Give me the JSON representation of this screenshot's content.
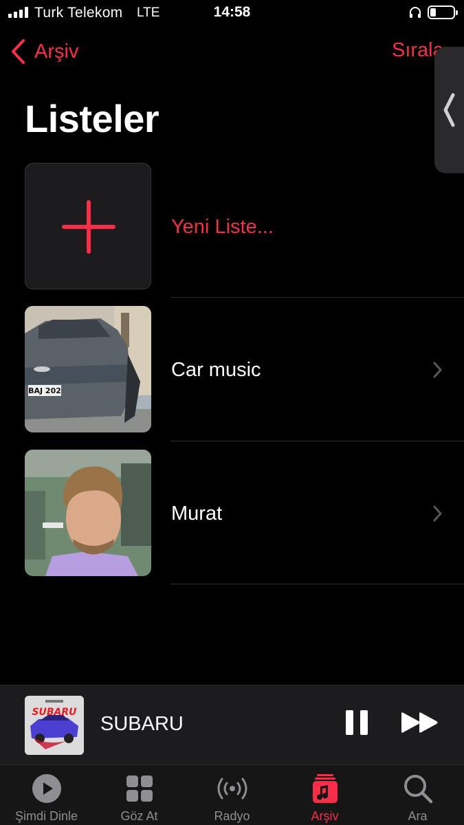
{
  "status_bar": {
    "carrier": "Turk Telekom",
    "network": "LTE",
    "time": "14:58",
    "battery_level": 0.25,
    "icons": [
      "signal-icon",
      "headphones-icon",
      "battery-icon"
    ]
  },
  "nav": {
    "back_label": "Arşiv",
    "sort_label": "Sırala"
  },
  "page": {
    "title": "Listeler"
  },
  "playlists": [
    {
      "label": "Yeni Liste...",
      "type": "new",
      "icon": "plus-icon"
    },
    {
      "label": "Car music",
      "type": "playlist",
      "artwork": "car-photo"
    },
    {
      "label": "Murat",
      "type": "playlist",
      "artwork": "person-photo"
    }
  ],
  "mini_player": {
    "title": "SUBARU",
    "artwork_text": "SUBARU",
    "state": "playing"
  },
  "tab_bar": {
    "tabs": [
      {
        "label": "Şimdi Dinle",
        "icon": "play-circle-icon"
      },
      {
        "label": "Göz At",
        "icon": "grid-icon"
      },
      {
        "label": "Radyo",
        "icon": "radio-icon"
      },
      {
        "label": "Arşiv",
        "icon": "library-icon",
        "active": true
      },
      {
        "label": "Ara",
        "icon": "search-icon"
      }
    ]
  },
  "colors": {
    "accent": "#fa2d48",
    "background": "#000000",
    "inactive": "#8e8e93"
  }
}
